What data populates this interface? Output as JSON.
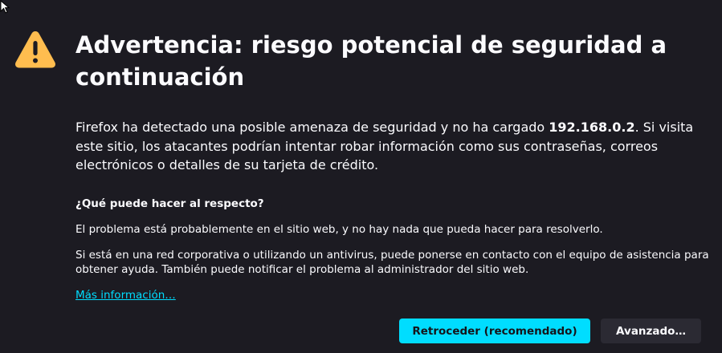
{
  "header": {
    "title": "Advertencia: riesgo potencial de seguridad a continuación",
    "icon": "warning-icon",
    "icon_color": "#ffbd4f"
  },
  "intro": {
    "before_host": "Firefox ha detectado una posible amenaza de seguridad y no ha cargado ",
    "host": "192.168.0.2",
    "after_host": ". Si visita este sitio, los atacantes podrían intentar robar información como sus contraseñas, correos electrónicos o detalles de su tarjeta de crédito."
  },
  "help": {
    "heading": "¿Qué puede hacer al respecto?",
    "paragraph1": "El problema está probablemente en el sitio web, y no hay nada que pueda hacer para resolverlo.",
    "paragraph2": "Si está en una red corporativa o utilizando un antivirus, puede ponerse en contacto con el equipo de asistencia para obtener ayuda. También puede notificar el problema al administrador del sitio web.",
    "more_link": "Más información…"
  },
  "buttons": {
    "primary_label": "Retroceder (recomendado)",
    "secondary_label": "Avanzado…"
  },
  "colors": {
    "background": "#1c1b22",
    "text": "#fbfbfe",
    "accent": "#00ddff",
    "secondary_button": "#2b2a33"
  }
}
